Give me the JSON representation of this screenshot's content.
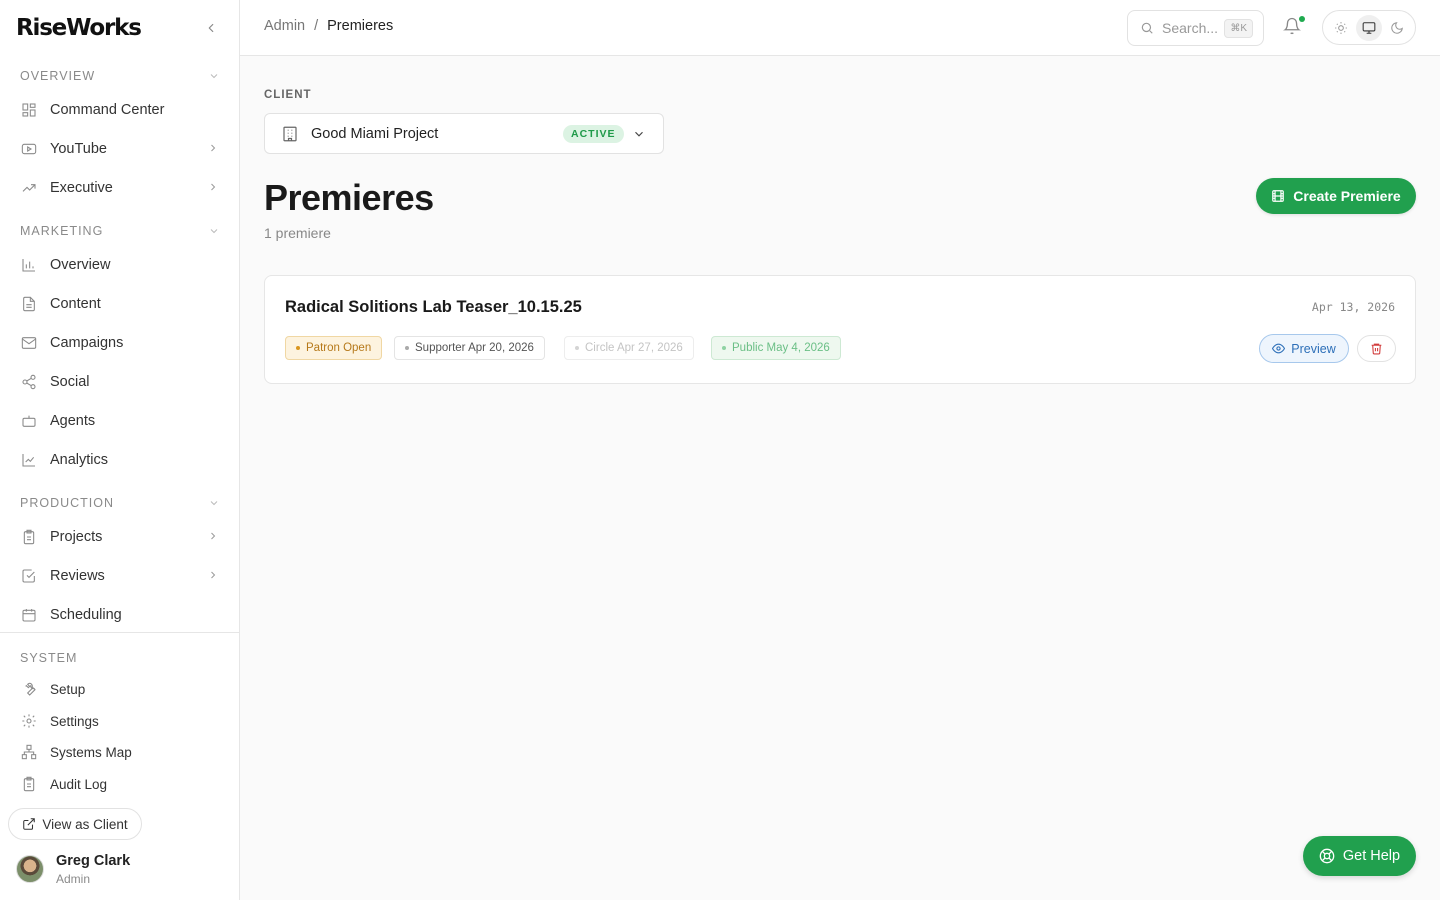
{
  "brand": {
    "name": "RiseWorks"
  },
  "sidebar": {
    "sections": [
      {
        "title": "OVERVIEW",
        "items": [
          {
            "label": "Command Center",
            "icon": "dashboard-icon",
            "has_arrow": false
          },
          {
            "label": "YouTube",
            "icon": "youtube-icon",
            "has_arrow": true
          },
          {
            "label": "Executive",
            "icon": "trend-icon",
            "has_arrow": true
          }
        ]
      },
      {
        "title": "MARKETING",
        "items": [
          {
            "label": "Overview",
            "icon": "bar-chart-icon",
            "has_arrow": false
          },
          {
            "label": "Content",
            "icon": "document-icon",
            "has_arrow": false
          },
          {
            "label": "Campaigns",
            "icon": "mail-icon",
            "has_arrow": false
          },
          {
            "label": "Social",
            "icon": "share-icon",
            "has_arrow": false
          },
          {
            "label": "Agents",
            "icon": "bot-icon",
            "has_arrow": false
          },
          {
            "label": "Analytics",
            "icon": "line-chart-icon",
            "has_arrow": false
          }
        ]
      },
      {
        "title": "PRODUCTION",
        "items": [
          {
            "label": "Projects",
            "icon": "clipboard-icon",
            "has_arrow": true
          },
          {
            "label": "Reviews",
            "icon": "check-square-icon",
            "has_arrow": true
          },
          {
            "label": "Scheduling",
            "icon": "calendar-icon",
            "has_arrow": false
          }
        ]
      }
    ],
    "system": {
      "title": "SYSTEM",
      "items": [
        {
          "label": "Setup",
          "icon": "wrench-icon"
        },
        {
          "label": "Settings",
          "icon": "gear-icon"
        },
        {
          "label": "Systems Map",
          "icon": "network-icon"
        },
        {
          "label": "Audit Log",
          "icon": "clipboard-icon"
        }
      ]
    },
    "view_as_client": "View as Client",
    "user": {
      "name": "Greg Clark",
      "role": "Admin"
    }
  },
  "topbar": {
    "breadcrumb": [
      "Admin",
      "Premieres"
    ],
    "search_placeholder": "Search...",
    "search_shortcut": "⌘K"
  },
  "client": {
    "label": "CLIENT",
    "name": "Good Miami Project",
    "status": "ACTIVE"
  },
  "page": {
    "title": "Premieres",
    "subtitle": "1 premiere",
    "create_button": "Create Premiere"
  },
  "premieres": [
    {
      "title": "Radical Solitions Lab Teaser_10.15.25",
      "date": "Apr 13, 2026",
      "tiers": {
        "patron": "Patron Open",
        "supporter": "Supporter Apr 20, 2026",
        "circle": "Circle Apr 27, 2026",
        "public": "Public May 4, 2026"
      },
      "preview_label": "Preview"
    }
  ],
  "help_button": "Get Help",
  "colors": {
    "accent_green": "#21a04e",
    "preview_blue": "#2d6fb8",
    "delete_red": "#d23b3b",
    "patron_amber": "#b6791a"
  }
}
